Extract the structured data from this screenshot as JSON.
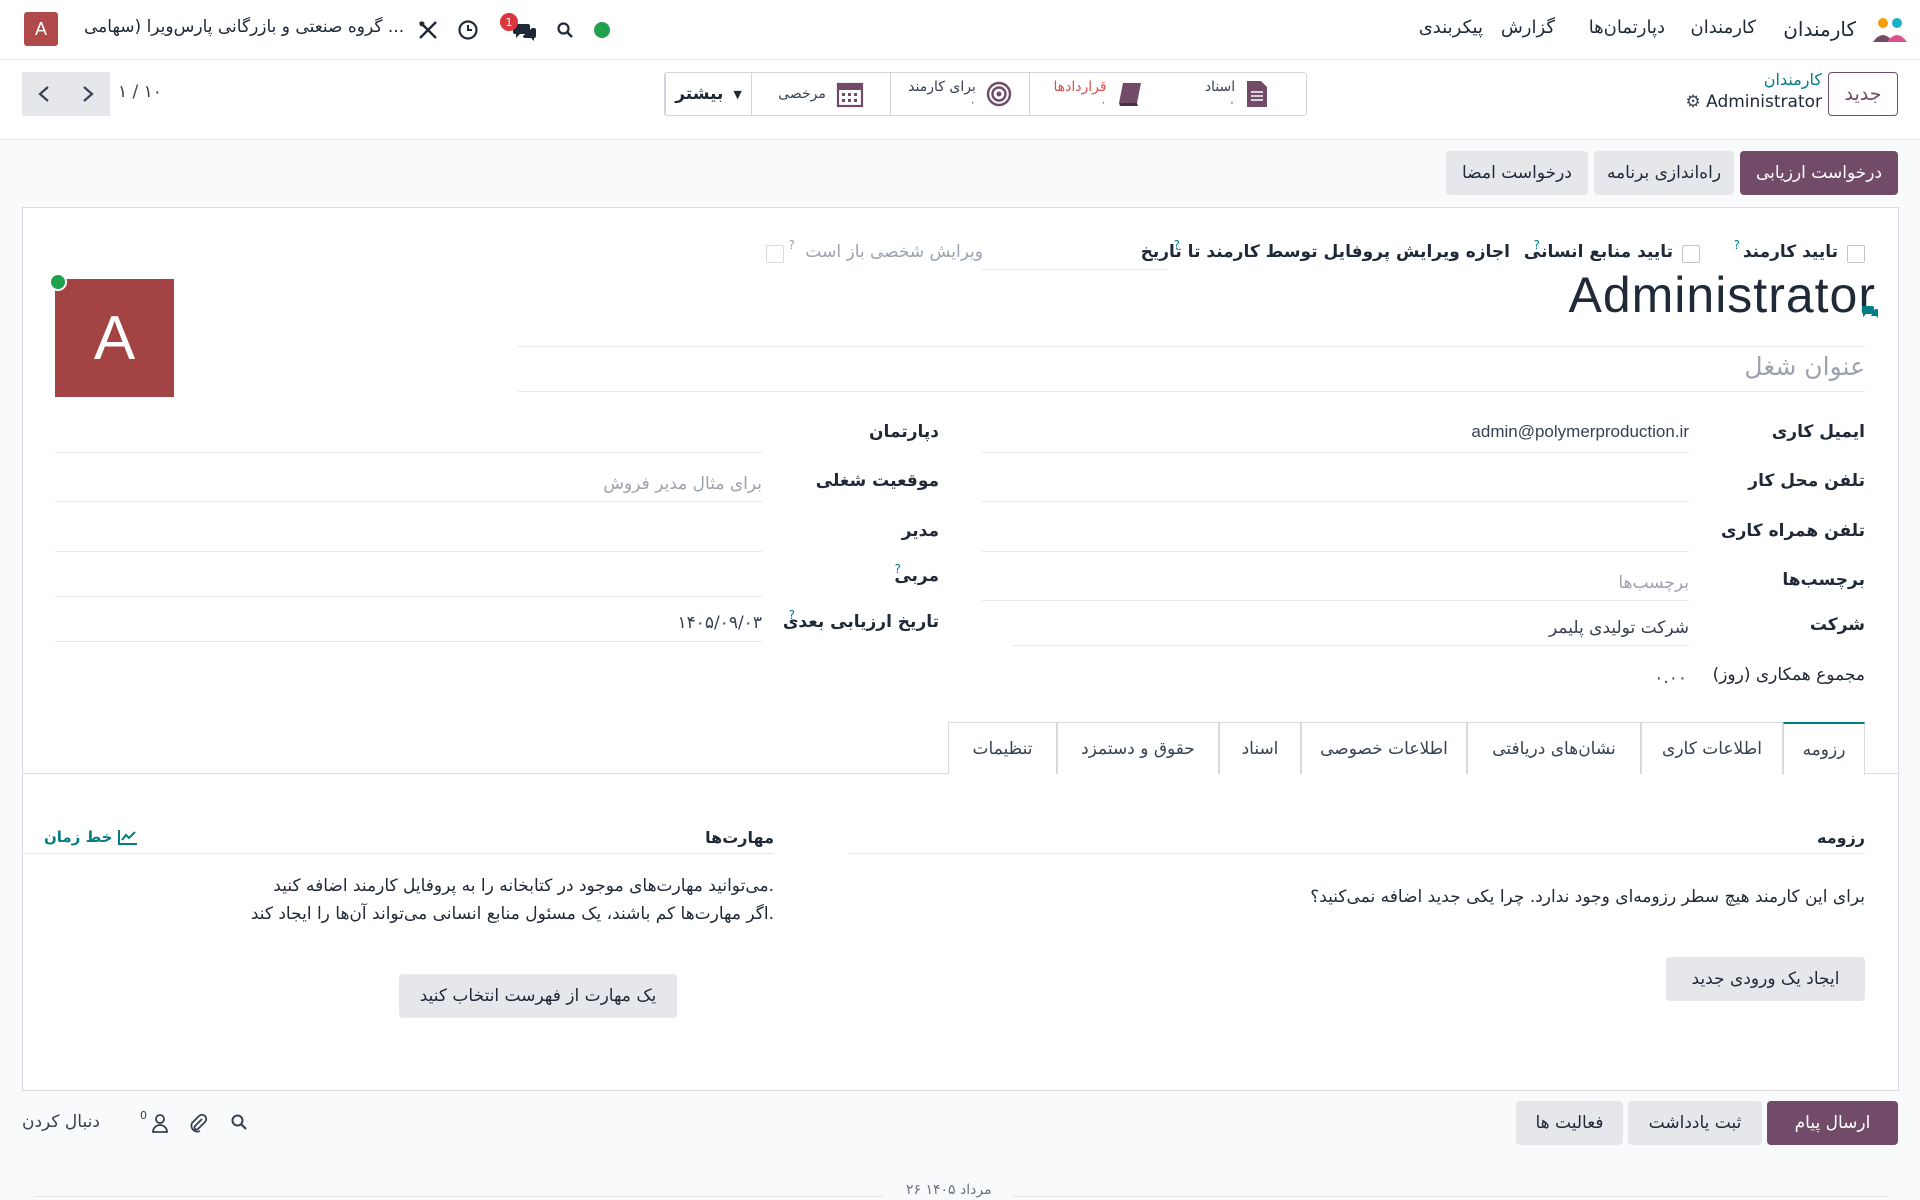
{
  "navbar": {
    "app_name": "کارمندان",
    "menu": [
      "کارمندان",
      "دپارتمان‌ها",
      "گزارش",
      "پیکربندی"
    ],
    "company": "گروه صنعتی و بازرگانی پارس‌ویرا (سهامی ...",
    "user_initial": "A",
    "chat_badge": "1",
    "status_color": "#22a04b"
  },
  "controlbar": {
    "new_label": "جدید",
    "breadcrumb_parent": "کارمندان",
    "breadcrumb_current": "Administrator",
    "smart_buttons": [
      {
        "label": "اسناد",
        "count": "۰",
        "icon": "document-icon"
      },
      {
        "label": "قراردادها",
        "count": "۰",
        "icon": "book-icon",
        "color": "#d9534f"
      },
      {
        "label": "برای کارمند",
        "count": "۰",
        "icon": "target-icon"
      },
      {
        "label": "مرخصی",
        "count": "",
        "icon": "calendar-icon"
      }
    ],
    "more_label": "بیشتر",
    "pager": "۱ / ۱۰"
  },
  "actions": {
    "appraisal": "درخواست ارزیابی",
    "launch_plan": "راه‌اندازی برنامه",
    "sign_request": "درخواست امضا"
  },
  "form": {
    "checks": {
      "employee_confirm": "تایید کارمند",
      "hr_confirm": "تایید منابع انسانی",
      "allow_edit": "اجازه ویرایش پروفایل توسط کارمند تا تاریخ",
      "personal_edit_open": "ویرایش شخصی باز است"
    },
    "name": "Administrator",
    "job_title_placeholder": "عنوان شغل",
    "avatar_initial": "A",
    "avatar_color": "#a44343",
    "fields_right": {
      "work_email_label": "ایمیل کاری",
      "work_email": "admin@polymerproduction.ir",
      "work_phone_label": "تلفن محل کار",
      "mobile_label": "تلفن همراه کاری",
      "tags_label": "برچسب‌ها",
      "tags_placeholder": "برچسب‌ها",
      "company_label": "شرکت",
      "company": "شرکت تولیدی پلیمر",
      "collab_label": "مجموع همکاری (روز)",
      "collab": "۰.۰۰"
    },
    "fields_left": {
      "department_label": "دپارتمان",
      "position_label": "موقعیت شغلی",
      "position_placeholder": "برای مثال مدیر فروش",
      "manager_label": "مدیر",
      "coach_label": "مربی",
      "next_appraisal_label": "تاریخ ارزیابی بعدی",
      "next_appraisal": "۱۴۰۵/۰۹/۰۳"
    },
    "tabs": [
      "رزومه",
      "اطلاعات کاری",
      "نشان‌های دریافتی",
      "اطلاعات خصوصی",
      "اسناد",
      "حقوق و دستمزد",
      "تنظیمات"
    ],
    "resume": {
      "title": "رزومه",
      "empty": "برای این کارمند هیچ سطر رزومه‌ای وجود ندارد. چرا یکی جدید اضافه نمی‌کنید؟",
      "create_btn": "ایجاد یک ورودی جدید"
    },
    "skills": {
      "title": "مهارت‌ها",
      "timeline": "خط زمان",
      "line1": "می‌توانید مهارت‌های موجود در کتابخانه را به پروفایل کارمند اضافه کنید.",
      "line2": "اگر مهارت‌ها کم باشند، یک مسئول منابع انسانی می‌تواند آن‌ها را ایجاد کند.",
      "pick_btn": "یک مهارت از فهرست انتخاب کنید"
    }
  },
  "chatter": {
    "send_message": "ارسال پیام",
    "log_note": "ثبت یادداشت",
    "activities": "فعالیت ها",
    "follow": "دنبال کردن",
    "followers_count": "0",
    "date_sep": "۲۶ مرداد ۱۴۰۵"
  }
}
